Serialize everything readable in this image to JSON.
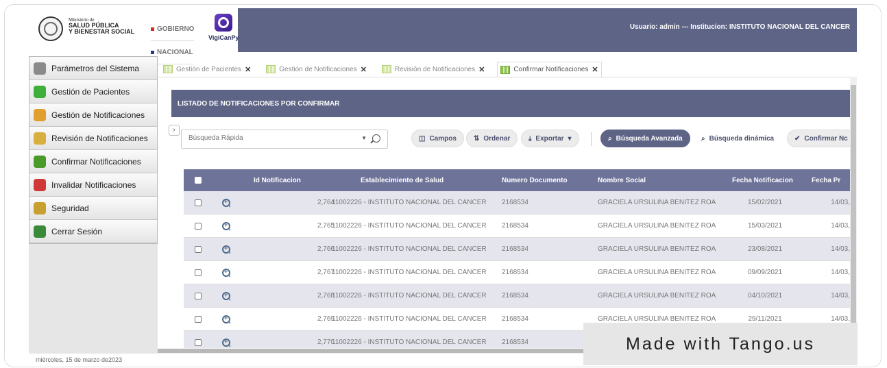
{
  "header": {
    "ministry_line1": "Ministerio de",
    "ministry_line2": "SALUD PÚBLICA",
    "ministry_line3": "Y BIENESTAR SOCIAL",
    "gob_line1": "GOBIERNO",
    "gob_line2": "NACIONAL",
    "app_name": "VigiCanPy",
    "user_info": "Usuario: admin --- Institucion: INSTITUTO NACIONAL DEL CANCER"
  },
  "sidebar": {
    "items": [
      {
        "label": "Parámetros del Sistema",
        "icon": "gear-icon",
        "color": "#8a8a8a"
      },
      {
        "label": "Gestión de Pacientes",
        "icon": "plus-circle-icon",
        "color": "#3fae3a"
      },
      {
        "label": "Gestión de Notificaciones",
        "icon": "edit-document-icon",
        "color": "#e0a030"
      },
      {
        "label": "Revisión de Notificaciones",
        "icon": "search-tool-icon",
        "color": "#d8b040"
      },
      {
        "label": "Confirmar Notificaciones",
        "icon": "checkmark-icon",
        "color": "#4a9a2a"
      },
      {
        "label": "Invalidar Notificaciones",
        "icon": "invalidate-icon",
        "color": "#d03838"
      },
      {
        "label": "Seguridad",
        "icon": "police-badge-icon",
        "color": "#c8a030"
      },
      {
        "label": "Cerrar Sesión",
        "icon": "exit-door-icon",
        "color": "#3a8a3a"
      }
    ],
    "date": "miércoles, 15 de marzo de2023"
  },
  "tabs": [
    {
      "label": "Gestión de Pacientes",
      "active": false
    },
    {
      "label": "Gestión de Notificaciones",
      "active": false
    },
    {
      "label": "Revisión de Notificaciones",
      "active": false
    },
    {
      "label": "Confirmar Notificaciones",
      "active": true
    }
  ],
  "main": {
    "title": "LISTADO DE NOTIFICACIONES POR CONFIRMAR",
    "search_placeholder": "Búsqueda Rápida",
    "buttons": {
      "campos": "Campos",
      "ordenar": "Ordenar",
      "exportar": "Exportar",
      "busqueda_avanzada": "Búsqueda Avanzada",
      "busqueda_dinamica": "Búsqueda dinámica",
      "confirmar": "Confirmar Nc"
    },
    "columns": [
      "Id Notificacion",
      "Establecimiento de Salud",
      "Numero Documento",
      "Nombre Social",
      "Fecha Notificacion",
      "Fecha Pr"
    ],
    "rows": [
      {
        "id": "2,764",
        "establecimiento": "11002226 - INSTITUTO NACIONAL DEL CANCER",
        "documento": "2168534",
        "nombre": "GRACIELA URSULINA BENITEZ ROA",
        "fecha": "15/02/2021",
        "fecha_pr": "14/03,"
      },
      {
        "id": "2,765",
        "establecimiento": "11002226 - INSTITUTO NACIONAL DEL CANCER",
        "documento": "2168534",
        "nombre": "GRACIELA URSULINA BENITEZ ROA",
        "fecha": "15/03/2021",
        "fecha_pr": "14/03,"
      },
      {
        "id": "2,766",
        "establecimiento": "11002226 - INSTITUTO NACIONAL DEL CANCER",
        "documento": "2168534",
        "nombre": "GRACIELA URSULINA BENITEZ ROA",
        "fecha": "23/08/2021",
        "fecha_pr": "14/03,"
      },
      {
        "id": "2,767",
        "establecimiento": "11002226 - INSTITUTO NACIONAL DEL CANCER",
        "documento": "2168534",
        "nombre": "GRACIELA URSULINA BENITEZ ROA",
        "fecha": "09/09/2021",
        "fecha_pr": "14/03,"
      },
      {
        "id": "2,768",
        "establecimiento": "11002226 - INSTITUTO NACIONAL DEL CANCER",
        "documento": "2168534",
        "nombre": "GRACIELA URSULINA BENITEZ ROA",
        "fecha": "04/10/2021",
        "fecha_pr": "14/03,"
      },
      {
        "id": "2,769",
        "establecimiento": "11002226 - INSTITUTO NACIONAL DEL CANCER",
        "documento": "2168534",
        "nombre": "GRACIELA URSULINA BENITEZ ROA",
        "fecha": "29/11/2021",
        "fecha_pr": "14/03,"
      },
      {
        "id": "2,770",
        "establecimiento": "11002226 - INSTITUTO NACIONAL DEL CANCER",
        "documento": "2168534",
        "nombre": "",
        "fecha": "",
        "fecha_pr": ""
      }
    ]
  },
  "watermark": "Made with Tango.us",
  "colors": {
    "header": "#5e6486",
    "table_header": "#6e739a",
    "row_alt": "#e5e5ee"
  }
}
